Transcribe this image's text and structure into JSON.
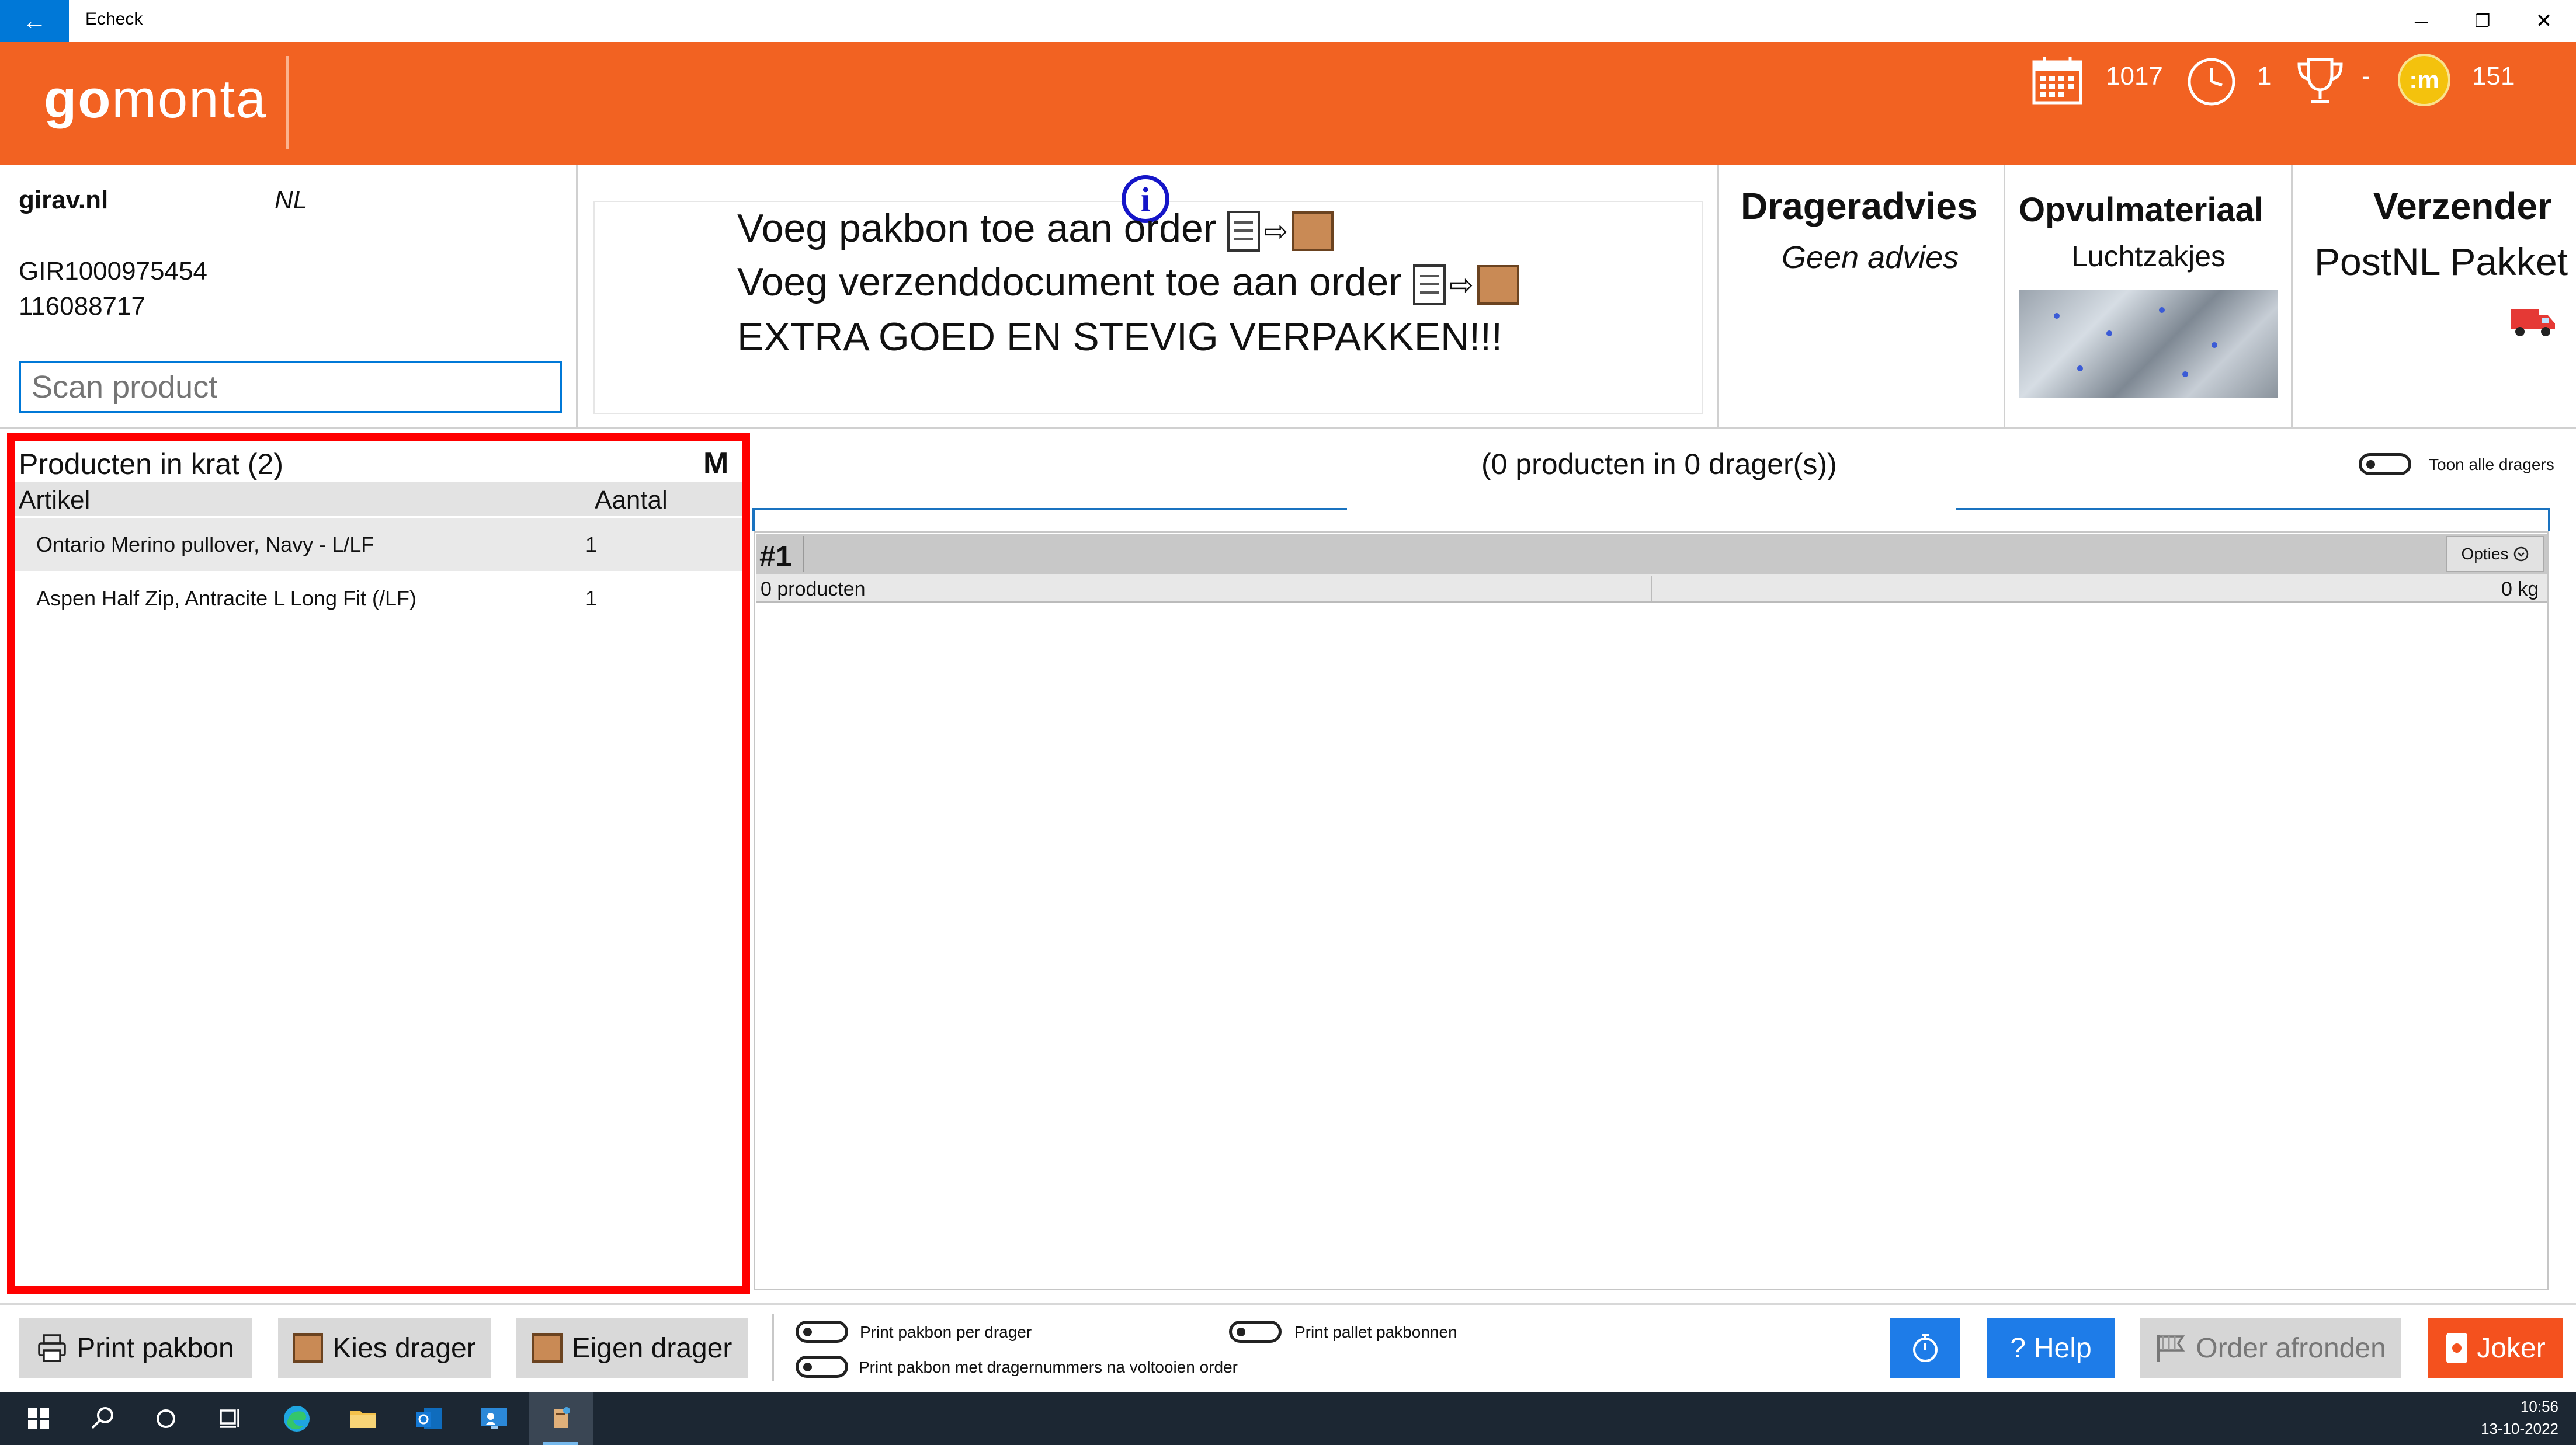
{
  "window": {
    "title": "Echeck",
    "back_icon": "←",
    "minimize_icon": "–",
    "restore_icon": "❐",
    "close_icon": "✕"
  },
  "header": {
    "logo_go": "go",
    "logo_monta": "monta",
    "stats": {
      "calendar_value": "1017",
      "clock_value": "1",
      "trophy_value": "-",
      "coin_label": ":m",
      "coin_value": "151"
    },
    "colors": {
      "header_bg": "#f26222",
      "accent_blue": "#0078d7",
      "highlight_red": "#ff0000"
    }
  },
  "order": {
    "shop": "girav.nl",
    "country": "NL",
    "order_number": "GIR1000975454",
    "reference": "116088717",
    "scan_placeholder": "Scan product"
  },
  "instructions": {
    "info_icon": "i",
    "line1": "Voeg pakbon toe aan order",
    "line2": "Voeg verzenddocument toe aan order",
    "line3": "EXTRA GOED EN STEVIG VERPAKKEN!!!",
    "arrow": "⇨"
  },
  "advice": {
    "drager_title": "Drageradvies",
    "drager_value": "Geen advies",
    "opvul_title": "Opvulmateriaal",
    "opvul_value": "Luchtzakjes",
    "verzender_title": "Verzender",
    "verzender_value": "PostNL Pakket"
  },
  "krat": {
    "title": "Producten in krat (2)",
    "size": "M",
    "col_artikel": "Artikel",
    "col_aantal": "Aantal",
    "rows": [
      {
        "artikel": "Ontario Merino pullover, Navy - L/LF",
        "aantal": "1"
      },
      {
        "artikel": "Aspen Half Zip, Antracite L Long Fit (/LF)",
        "aantal": "1"
      }
    ]
  },
  "carriers": {
    "summary": "(0 producten in 0 drager(s))",
    "toggle_all_label": "Toon alle dragers",
    "carrier_id": "#1",
    "opties_label": "Opties",
    "products_label": "0 producten",
    "weight_label": "0 kg"
  },
  "bottom": {
    "print_pakbon": "Print pakbon",
    "kies_drager": "Kies drager",
    "eigen_drager": "Eigen drager",
    "toggle_per_drager": "Print pakbon per drager",
    "toggle_dragernummers": "Print pakbon met dragernummers na voltooien order",
    "toggle_pallet": "Print pallet pakbonnen",
    "help": "Help",
    "help_icon": "?",
    "order_afronden": "Order afronden",
    "joker": "Joker"
  },
  "taskbar": {
    "start_icon": "windows-start-icon",
    "time": "10:56",
    "date": "13-10-2022"
  }
}
